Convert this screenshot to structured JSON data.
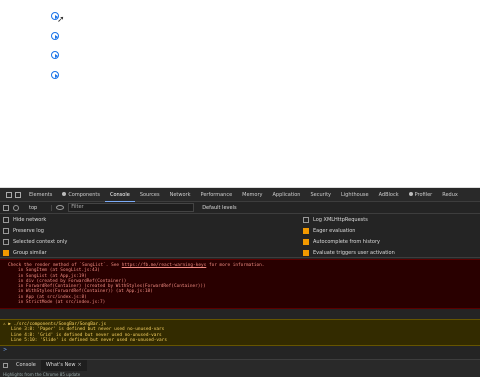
{
  "devtools": {
    "tabs": [
      {
        "label": "Elements"
      },
      {
        "label": "Components",
        "icon": "react-dot-icon"
      },
      {
        "label": "Console",
        "active": true
      },
      {
        "label": "Sources"
      },
      {
        "label": "Network"
      },
      {
        "label": "Performance"
      },
      {
        "label": "Memory"
      },
      {
        "label": "Application"
      },
      {
        "label": "Security"
      },
      {
        "label": "Lighthouse"
      },
      {
        "label": "AdBlock"
      },
      {
        "label": "Profiler",
        "icon": "react-dot-icon"
      },
      {
        "label": "Redux"
      }
    ],
    "toolbar": {
      "context": "top",
      "filter_placeholder": "Filter",
      "levels": "Default levels"
    },
    "settings": {
      "left": [
        {
          "label": "Hide network",
          "checked": false
        },
        {
          "label": "Preserve log",
          "checked": false
        },
        {
          "label": "Selected context only",
          "checked": false
        },
        {
          "label": "Group similar",
          "checked": true
        }
      ],
      "right": [
        {
          "label": "Log XMLHttpRequests",
          "checked": false
        },
        {
          "label": "Eager evaluation",
          "checked": true
        },
        {
          "label": "Autocomplete from history",
          "checked": true
        },
        {
          "label": "Evaluate triggers user activation",
          "checked": true
        }
      ]
    },
    "error": {
      "text": "Check the render method of `SongList`. See",
      "link": "https://fb.me/react-warning-keys",
      "text_after": "for more information.",
      "stack": [
        "in SongItem (at SongList.js:43)",
        "in SongList (at App.js:19)",
        "in div (created by ForwardRef(Container))",
        "in ForwardRef(Container) (created by WithStyles(ForwardRef(Container)))",
        "in WithStyles(ForwardRef(Container)) (at App.js:18)",
        "in App (at src/index.js:8)",
        "in StrictMode (at src/index.js:7)"
      ]
    },
    "warning": {
      "header": "▶ ./src/components/SongBar/SongBar.js",
      "lines": [
        "Line 3:8:   'Paper' is defined but never used  no-unused-vars",
        "Line 4:8:   'Grid' is defined but never used  no-unused-vars",
        "Line 5:10:  'Slide' is defined but never used  no-unused-vars"
      ]
    },
    "prompt": ">",
    "drawer": {
      "tabs": [
        {
          "label": "Console"
        },
        {
          "label": "What's New",
          "active": true
        }
      ],
      "close": "×",
      "subtitle": "Highlights from the Chrome 85 update"
    }
  },
  "colors": {
    "accent": "#1a73e8",
    "checkbox": "#f29900",
    "error": "#f28b82",
    "warning": "#fdd663"
  }
}
